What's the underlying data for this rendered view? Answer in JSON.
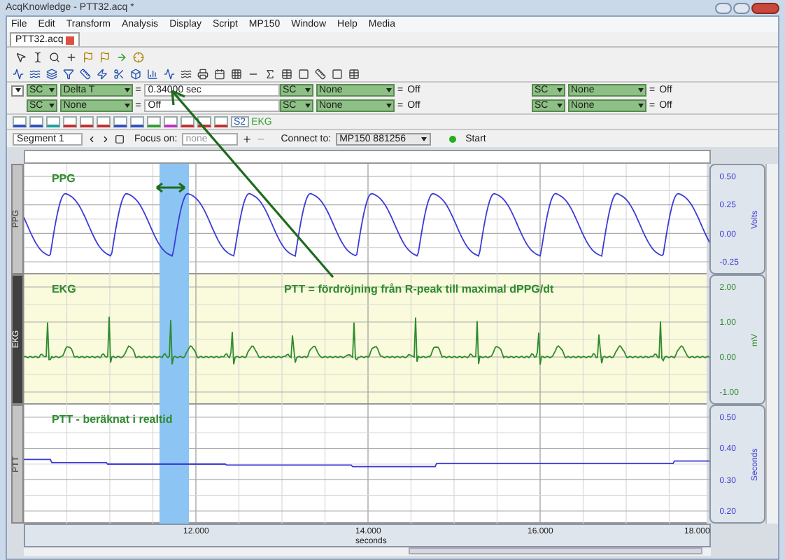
{
  "window": {
    "title": "AcqKnowledge - PTT32.acq *"
  },
  "menu": [
    "File",
    "Edit",
    "Transform",
    "Analysis",
    "Display",
    "Script",
    "MP150",
    "Window",
    "Help",
    "Media"
  ],
  "document_tabs": [
    {
      "label": "PTT32.acq",
      "selected": true
    }
  ],
  "measurements": [
    {
      "cells": [
        {
          "channel": "SC",
          "function": "Delta T",
          "operator": "=",
          "value": "0.34000 sec"
        },
        {
          "channel": "SC",
          "function": "None",
          "operator": "=",
          "value": "Off"
        },
        {
          "channel": "SC",
          "function": "None",
          "operator": "=",
          "value": "Off"
        }
      ]
    },
    {
      "cells": [
        {
          "channel": "SC",
          "function": "None",
          "operator": "=",
          "value": "Off"
        },
        {
          "channel": "SC",
          "function": "None",
          "operator": "=",
          "value": "Off"
        },
        {
          "channel": "SC",
          "function": "None",
          "operator": "=",
          "value": "Off"
        }
      ]
    }
  ],
  "channel_bar": {
    "button": "S2",
    "channel": "EKG"
  },
  "segment": {
    "value": "Segment 1"
  },
  "focus": {
    "label": "Focus on:",
    "placeholder": "none"
  },
  "connect": {
    "label": "Connect to:",
    "value": "MP150 881256"
  },
  "start": {
    "label": "Start"
  },
  "channels": [
    {
      "kind": "ppg",
      "name": "PPG",
      "selected": false,
      "color": "#3b3bd6",
      "unit": "Volts",
      "yticks": [
        "0.50",
        "0.25",
        "0.00",
        "-0.25"
      ],
      "annotations": [
        {
          "text": "PPG"
        }
      ]
    },
    {
      "kind": "ecg",
      "name": "EKG",
      "selected": true,
      "color": "#2e8b2e",
      "unit": "mV",
      "yticks": [
        "2.00",
        "1.00",
        "0.00",
        "-1.00"
      ],
      "annotations": [
        {
          "text": "EKG"
        },
        {
          "text": "PTT = fördröjning från R-peak till maximal dPPG/dt"
        }
      ]
    },
    {
      "kind": "ptt",
      "name": "PTT",
      "selected": false,
      "color": "#3b3bd6",
      "unit": "Seconds",
      "yticks": [
        "0.50",
        "0.40",
        "0.30",
        "0.20"
      ],
      "annotations": [
        {
          "text": "PTT - beräknat i realtid"
        }
      ]
    }
  ],
  "x_axis": {
    "ticks": [
      "12.000",
      "14.000",
      "16.000",
      "18.000"
    ],
    "label": "seconds"
  }
}
